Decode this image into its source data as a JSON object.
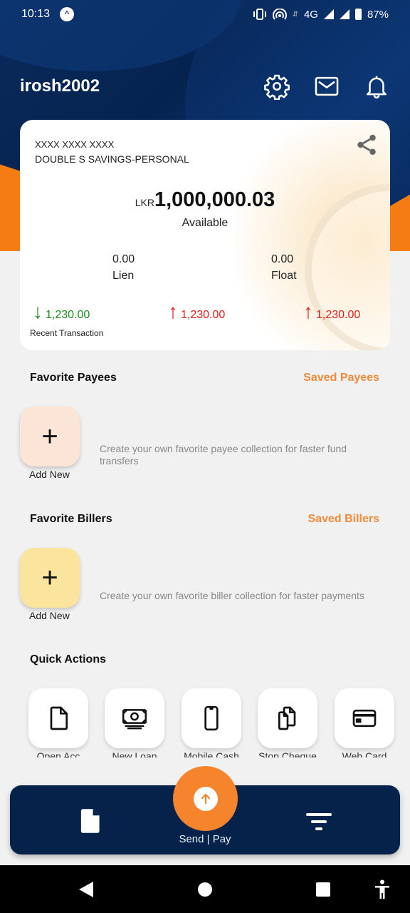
{
  "status_bar": {
    "time": "10:13",
    "network": "4G",
    "battery": "87%",
    "icons": [
      "app-notification-icon",
      "vibrate-icon",
      "hotspot-icon",
      "data-arrows-icon",
      "signal-icon",
      "signal-icon",
      "battery-icon"
    ]
  },
  "header": {
    "username": "irosh2002",
    "icons": [
      "gear-icon",
      "mail-icon",
      "bell-icon"
    ]
  },
  "account_card": {
    "account_number": "XXXX XXXX XXXX",
    "account_type": "DOUBLE S SAVINGS-PERSONAL",
    "currency": "LKR",
    "balance": "1,000,000.03",
    "balance_label": "Available",
    "lien_value": "0.00",
    "lien_label": "Lien",
    "float_value": "0.00",
    "float_label": "Float",
    "transactions": [
      {
        "direction": "down",
        "amount": "1,230.00",
        "color": "#1d8a1d"
      },
      {
        "direction": "up",
        "amount": "1,230.00",
        "color": "#e21b1b"
      },
      {
        "direction": "up",
        "amount": "1,230.00",
        "color": "#e21b1b"
      }
    ],
    "recent_label": "Recent Transaction",
    "arrow_down": "↓",
    "arrow_up": "↑"
  },
  "favorite_payees": {
    "title": "Favorite Payees",
    "link": "Saved Payees",
    "add_label": "Add New",
    "hint": "Create your own favorite payee collection for faster fund transfers",
    "tile_color": "#fbe5d6"
  },
  "favorite_billers": {
    "title": "Favorite Billers",
    "link": "Saved Billers",
    "add_label": "Add New",
    "hint": "Create your own favorite biller collection for faster payments",
    "tile_color": "#fbe59e"
  },
  "quick_actions": {
    "title": "Quick Actions",
    "items": [
      {
        "label": "Open Acc",
        "icon": "document-icon"
      },
      {
        "label": "New Loan",
        "icon": "cash-icon"
      },
      {
        "label": "Mobile Cash",
        "icon": "phone-icon"
      },
      {
        "label": "Stop Cheque",
        "icon": "copy-documents-icon"
      },
      {
        "label": "Web Card",
        "icon": "credit-card-icon"
      }
    ]
  },
  "bottom_nav": {
    "center_label": "Send | Pay",
    "plus": "+",
    "accent": "#f5842c",
    "background": "#05224a"
  }
}
